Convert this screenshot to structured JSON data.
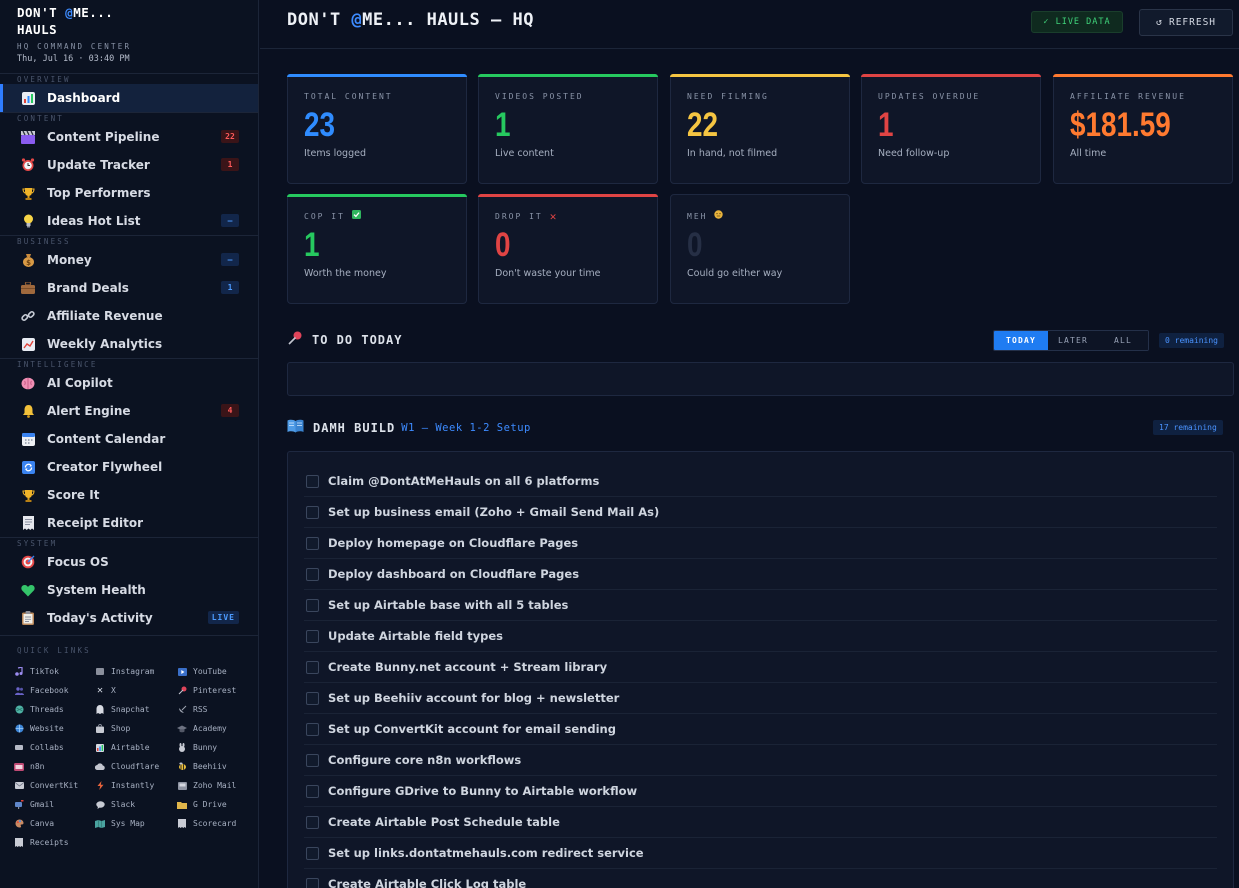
{
  "brand": {
    "title_a": "DON'T ",
    "title_at": "@",
    "title_b": "ME...\nHAULS",
    "subtitle": "HQ COMMAND CENTER",
    "datetime": "Thu, Jul 16 · 03:40 PM"
  },
  "sidebar": {
    "sections": {
      "overview": "OVERVIEW",
      "content": "CONTENT",
      "business": "BUSINESS",
      "intelligence": "INTELLIGENCE",
      "system": "SYSTEM"
    },
    "items": {
      "dashboard": "Dashboard",
      "content_pipeline": "Content Pipeline",
      "update_tracker": "Update Tracker",
      "top_performers": "Top Performers",
      "ideas_hot_list": "Ideas Hot List",
      "money": "Money",
      "brand_deals": "Brand Deals",
      "affiliate_revenue": "Affiliate Revenue",
      "weekly_analytics": "Weekly Analytics",
      "ai_copilot": "AI Copilot",
      "alert_engine": "Alert Engine",
      "content_calendar": "Content Calendar",
      "creator_flywheel": "Creator Flywheel",
      "score_it": "Score It",
      "receipt_editor": "Receipt Editor",
      "focus_os": "Focus OS",
      "system_health": "System Health",
      "todays_activity": "Today's Activity"
    },
    "badges": {
      "content_pipeline": "22",
      "update_tracker": "1",
      "ideas_hot_list": "—",
      "money": "—",
      "brand_deals": "1",
      "alert_engine": "4",
      "todays_activity": "LIVE"
    }
  },
  "quick_links": {
    "title": "QUICK LINKS",
    "items": [
      "TikTok",
      "Instagram",
      "YouTube",
      "Facebook",
      "X",
      "Pinterest",
      "Threads",
      "Snapchat",
      "RSS",
      "Website",
      "Shop",
      "Academy",
      "Collabs",
      "Airtable",
      "Bunny",
      "n8n",
      "Cloudflare",
      "Beehiiv",
      "ConvertKit",
      "Instantly",
      "Zoho Mail",
      "Gmail",
      "Slack",
      "G Drive",
      "Canva",
      "Sys Map",
      "Scorecard",
      "Receipts"
    ]
  },
  "header": {
    "title_a": "DON'T ",
    "title_at": "@",
    "title_b": "ME... HAULS — HQ",
    "live_badge": "✓ LIVE DATA",
    "refresh_label": "REFRESH"
  },
  "stats": {
    "total_content": {
      "label": "TOTAL CONTENT",
      "value": "23",
      "sub": "Items logged"
    },
    "videos_posted": {
      "label": "VIDEOS POSTED",
      "value": "1",
      "sub": "Live content"
    },
    "need_filming": {
      "label": "NEED FILMING",
      "value": "22",
      "sub": "In hand, not filmed"
    },
    "updates_overdue": {
      "label": "UPDATES OVERDUE",
      "value": "1",
      "sub": "Need follow-up"
    },
    "affiliate_revenue": {
      "label": "AFFILIATE REVENUE",
      "value": "$181.59",
      "sub": "All time"
    },
    "cop_it": {
      "label": "COP IT",
      "value": "1",
      "sub": "Worth the money"
    },
    "drop_it": {
      "label": "DROP IT",
      "value": "0",
      "sub": "Don't waste your time"
    },
    "meh": {
      "label": "MEH",
      "value": "0",
      "sub": "Could go either way"
    }
  },
  "colors": {
    "blue": "#2f8cff",
    "green": "#26c95f",
    "yellow": "#f5c542",
    "red": "#e04444",
    "orange": "#ff7a30"
  },
  "todo": {
    "title": "TO DO TODAY",
    "tabs": {
      "today": "TODAY",
      "later": "LATER",
      "all": "ALL"
    },
    "remaining": "0 remaining"
  },
  "build": {
    "title": "DAMH BUILD",
    "subtitle": "W1 — Week 1-2 Setup",
    "remaining": "17 remaining",
    "tasks": [
      "Claim @DontAtMeHauls on all 6 platforms",
      "Set up business email (Zoho + Gmail Send Mail As)",
      "Deploy homepage on Cloudflare Pages",
      "Deploy dashboard on Cloudflare Pages",
      "Set up Airtable base with all 5 tables",
      "Update Airtable field types",
      "Create Bunny.net account + Stream library",
      "Set up Beehiiv account for blog + newsletter",
      "Set up ConvertKit account for email sending",
      "Configure core n8n workflows",
      "Configure GDrive to Bunny to Airtable workflow",
      "Create Airtable Post Schedule table",
      "Set up links.dontatmehauls.com redirect service",
      "Create Airtable Click Log table"
    ]
  }
}
